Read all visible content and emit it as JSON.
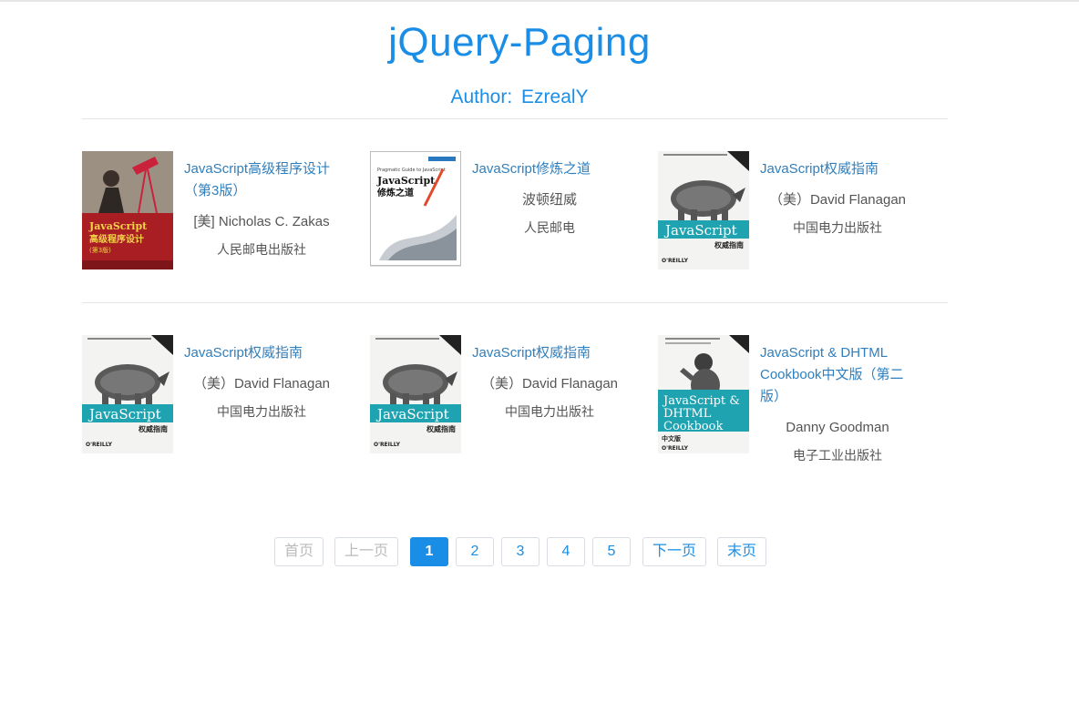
{
  "header": {
    "title": "jQuery-Paging",
    "author_label": "Author:",
    "author_name": "EzrealY"
  },
  "books": [
    {
      "title": "JavaScript高级程序设计（第3版）",
      "author": "[美] Nicholas C. Zakas",
      "publisher": "人民邮电出版社",
      "cover": "zakas-cover"
    },
    {
      "title": "JavaScript修炼之道",
      "author": "波顿纽威",
      "publisher": "人民邮电",
      "cover": "pragmatic-cover"
    },
    {
      "title": "JavaScript权威指南",
      "author": "（美）David Flanagan",
      "publisher": "中国电力出版社",
      "cover": "rhino-cover"
    },
    {
      "title": "JavaScript权威指南",
      "author": "（美）David Flanagan",
      "publisher": "中国电力出版社",
      "cover": "rhino-cover"
    },
    {
      "title": "JavaScript权威指南",
      "author": "（美）David Flanagan",
      "publisher": "中国电力出版社",
      "cover": "rhino-cover"
    },
    {
      "title": "JavaScript & DHTML Cookbook中文版（第二版）",
      "author": "Danny Goodman",
      "publisher": "电子工业出版社",
      "cover": "cookbook-cover"
    }
  ],
  "covers": {
    "zakas": {
      "line1": "JavaScript",
      "line2": "高级程序设计",
      "line3": "(第3版)"
    },
    "pragmatic": {
      "top": "Pragmatic Guide to JavaScript",
      "line1": "JavaScript",
      "line2": "修炼之道"
    },
    "rhino": {
      "word": "JavaScript",
      "sub": "权威指南",
      "brand": "O'REILLY"
    },
    "cookbook": {
      "line1": "JavaScript &",
      "line2": "DHTML",
      "line3": "Cookbook",
      "sub": "中文版",
      "brand": "O'REILLY"
    }
  },
  "pagination": {
    "first": "首页",
    "prev": "上一页",
    "pages": [
      "1",
      "2",
      "3",
      "4",
      "5"
    ],
    "current": "1",
    "next": "下一页",
    "last": "末页"
  },
  "colors": {
    "accent": "#1a8ee6",
    "link": "#2f7fbe",
    "text": "#555555",
    "divider": "#e5e5e5"
  }
}
